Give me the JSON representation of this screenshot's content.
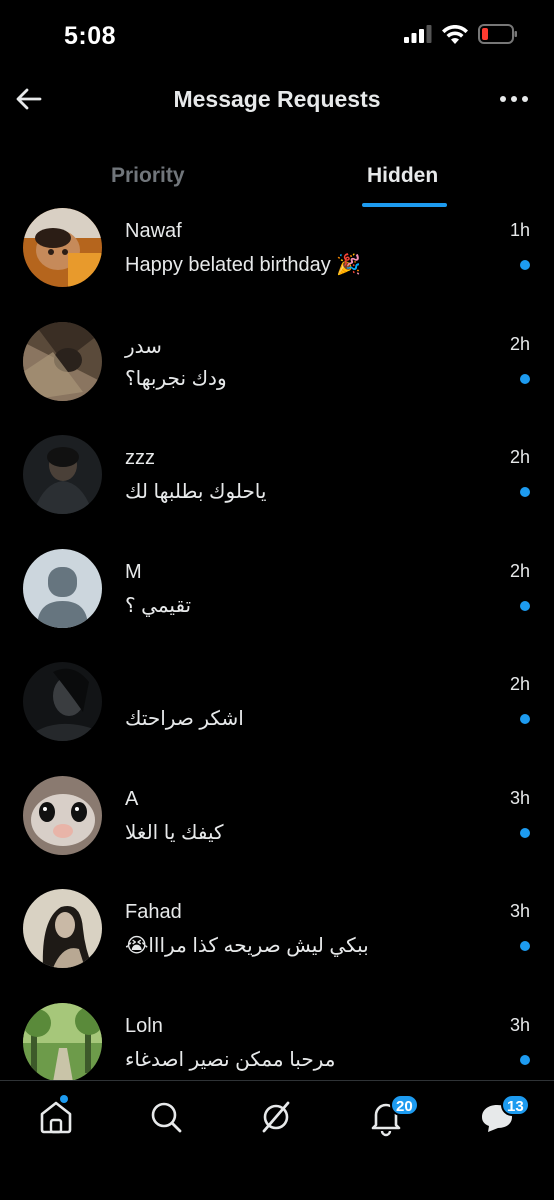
{
  "status": {
    "time": "5:08"
  },
  "header": {
    "title": "Message Requests"
  },
  "tabs": [
    {
      "label": "Priority"
    },
    {
      "label": "Hidden"
    }
  ],
  "requests": [
    {
      "name": "Nawaf",
      "message": "Happy belated birthday 🎉",
      "time": "1h"
    },
    {
      "name": "سدر",
      "message": "ودك نجربها؟",
      "time": "2h"
    },
    {
      "name": "zzz",
      "message": "ياحلوك بطلبها لك",
      "time": "2h"
    },
    {
      "name": "M",
      "message": "تقيمي ؟",
      "time": "2h"
    },
    {
      "name": "",
      "message": "اشكر صراحتك",
      "time": "2h"
    },
    {
      "name": "A",
      "message": "كيفك يا الغلا",
      "time": "3h"
    },
    {
      "name": "Fahad",
      "message": "ببكي ليش صريحه كذا مرااا😭",
      "time": "3h"
    },
    {
      "name": "Loln",
      "message": "مرحبا ممكن نصير اصدغاء",
      "time": "3h"
    }
  ],
  "nav": {
    "notifications_badge": "20",
    "messages_badge": "13"
  },
  "colors": {
    "accent": "#1d9bf0",
    "background": "#000000",
    "muted": "#71767b"
  }
}
